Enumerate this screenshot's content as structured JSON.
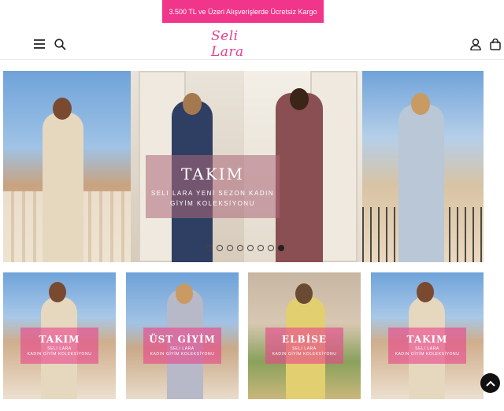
{
  "promo": {
    "text": "3.500 TL ve Üzeri Alışverişlerde Ücretsiz Kargo",
    "bg_color": "#f0358a"
  },
  "header": {
    "logo_text": "Seli Lara",
    "logo_color": "#e23f8f",
    "icons": [
      "menu-icon",
      "search-icon",
      "user-icon",
      "cart-icon"
    ]
  },
  "hero": {
    "title": "TAKIM",
    "subtitle_line1": "SELI LARA YENİ SEZON KADIN",
    "subtitle_line2": "GİYİM KOLEKSİYONU",
    "slide_count": 8,
    "active_slide": 8
  },
  "categories": [
    {
      "title": "TAKIM",
      "sub1": "SELI LARA",
      "sub2": "KADIN GİYİM KOLEKSİYONU"
    },
    {
      "title": "ÜST GİYİM",
      "sub1": "SELI LARA",
      "sub2": "KADIN GİYİM KOLEKSİYONU"
    },
    {
      "title": "ELBİSE",
      "sub1": "SELI LARA",
      "sub2": "KADIN GİYİM KOLEKSİYONU"
    },
    {
      "title": "TAKIM",
      "sub1": "SELI LARA",
      "sub2": "KADIN GİYİM KOLEKSİYONU"
    }
  ],
  "back_to_top_icon": "chevron-up-icon"
}
